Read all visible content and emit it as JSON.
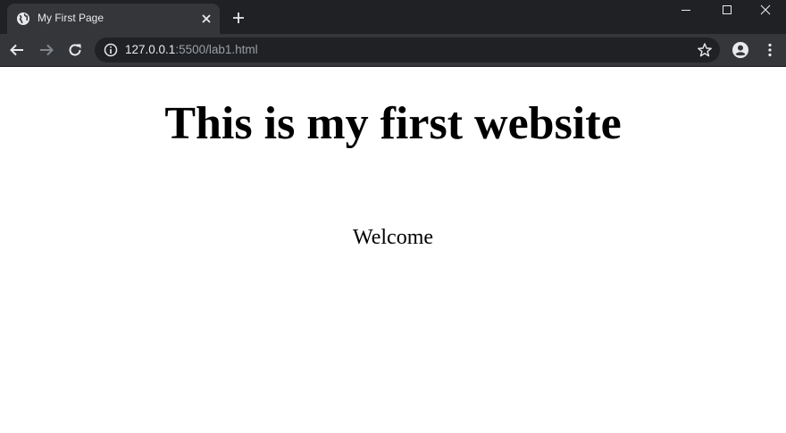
{
  "browser": {
    "tab": {
      "title": "My First Page"
    },
    "address_bar": {
      "host": "127.0.0.1",
      "rest": ":5500/lab1.html"
    }
  },
  "page": {
    "heading": "This is my first website",
    "welcome": "Welcome"
  },
  "colors": {
    "titlebar": "#202124",
    "toolbar": "#35363a",
    "omnibox": "#202124",
    "text_light": "#e8eaed",
    "text_dim": "#9aa0a6"
  },
  "icons": [
    "globe-icon",
    "close-tab-icon",
    "new-tab-icon",
    "minimize-icon",
    "maximize-icon",
    "close-window-icon",
    "back-icon",
    "forward-icon",
    "reload-icon",
    "info-icon",
    "star-icon",
    "profile-icon",
    "menu-icon"
  ]
}
